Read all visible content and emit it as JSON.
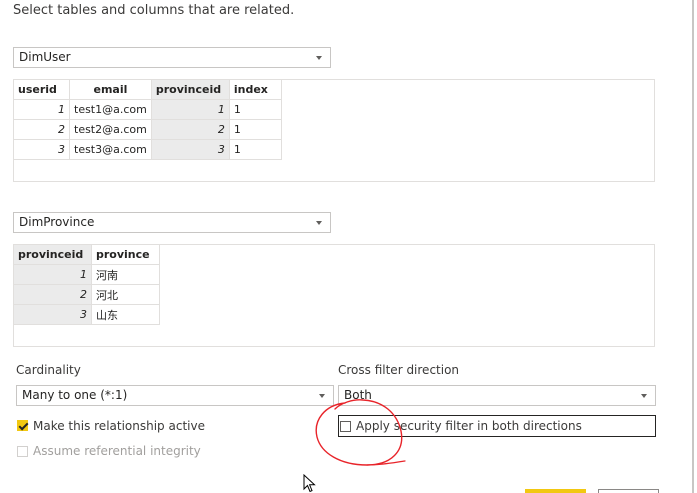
{
  "instruction": "Select tables and columns that are related.",
  "table1": {
    "select_value": "DimUser",
    "columns": [
      "userid",
      "email",
      "provinceid",
      "index"
    ],
    "rows": [
      [
        "1",
        "test1@a.com",
        "1",
        "1"
      ],
      [
        "2",
        "test2@a.com",
        "2",
        "1"
      ],
      [
        "3",
        "test3@a.com",
        "3",
        "1"
      ]
    ]
  },
  "table2": {
    "select_value": "DimProvince",
    "columns": [
      "provinceid",
      "province"
    ],
    "rows": [
      [
        "1",
        "河南"
      ],
      [
        "2",
        "河北"
      ],
      [
        "3",
        "山东"
      ]
    ]
  },
  "cardinality": {
    "label": "Cardinality",
    "value": "Many to one (*:1)"
  },
  "cross_filter": {
    "label": "Cross filter direction",
    "value": "Both"
  },
  "options": {
    "make_active": {
      "label": "Make this relationship active",
      "checked": true
    },
    "security_filter": {
      "label": "Apply security filter in both directions",
      "checked": false
    },
    "referential_integrity": {
      "label": "Assume referential integrity",
      "checked": false,
      "disabled": true
    }
  },
  "colors": {
    "accent": "#f2c811",
    "annotation": "#e8242a"
  },
  "icons": [
    "chevron-down-icon",
    "checkmark-icon",
    "mouse-cursor-icon"
  ]
}
